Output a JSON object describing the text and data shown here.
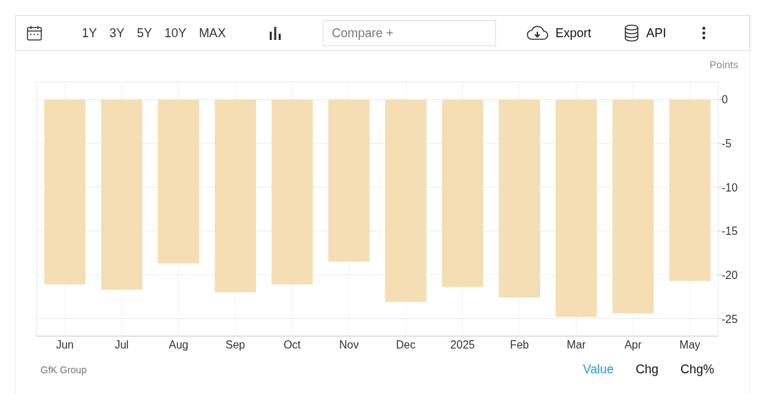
{
  "toolbar": {
    "ranges": [
      {
        "label": "1Y",
        "selected": false
      },
      {
        "label": "3Y",
        "selected": false
      },
      {
        "label": "5Y",
        "selected": false
      },
      {
        "label": "10Y",
        "selected": false
      },
      {
        "label": "MAX",
        "selected": false
      }
    ],
    "compare": {
      "placeholder": "Compare +"
    },
    "actions": [
      {
        "kind": "export",
        "label": "Export"
      },
      {
        "kind": "api",
        "label": "API"
      }
    ]
  },
  "chart": {
    "chart_data": {
      "type": "bar",
      "ylabel": "Points",
      "categories": [
        "Jun",
        "Jul",
        "Aug",
        "Sep",
        "Oct",
        "Nov",
        "Dec",
        "2025",
        "Feb",
        "Mar",
        "Apr",
        "May"
      ],
      "grid": true,
      "series": [
        {
          "color": "#f5deb3",
          "values": [
            -21.1,
            -21.7,
            -18.7,
            -22.0,
            -21.1,
            -18.5,
            -23.1,
            -21.4,
            -22.6,
            -24.8,
            -24.4,
            -20.7
          ]
        }
      ],
      "ylim": [
        -27,
        2
      ],
      "yticks": [
        0,
        -5,
        -10,
        -15,
        -20,
        -25
      ]
    }
  },
  "footer": {
    "source": "GfK Group",
    "views": [
      {
        "label": "Value",
        "selected": true
      },
      {
        "label": "Chg",
        "selected": false
      },
      {
        "label": "Chg%",
        "selected": false
      }
    ]
  }
}
